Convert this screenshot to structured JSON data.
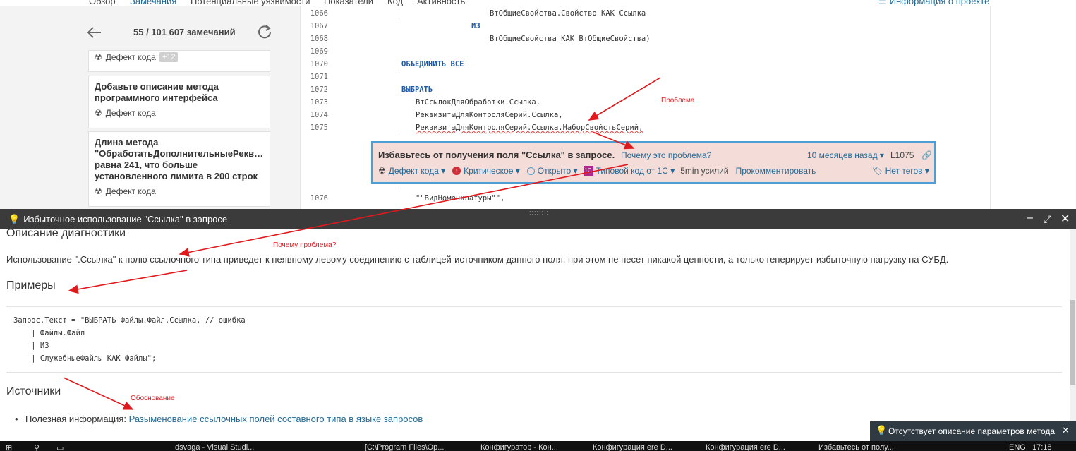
{
  "nav": {
    "tabs": [
      "Обзор",
      "Замечания",
      "Потенциальные уязвимости",
      "Показатели",
      "Код",
      "Активность"
    ],
    "project_info": "Информация о проекте"
  },
  "issues_list": {
    "counter": "55 / 101 607 замечаний",
    "cards": [
      {
        "title": "",
        "type": "Дефект кода",
        "badge": "+12"
      },
      {
        "title": "Добавьте описание метода программного интерфейса",
        "type": "Дефект кода"
      },
      {
        "title": "Длина метода \"ОбработатьДополнительныеРекв… равна 241, что больше установленного лимита в 200 строк",
        "type": "Дефект кода"
      }
    ]
  },
  "code": {
    "lines": [
      {
        "n": "1066",
        "text": "ВтОбщиеСвойства.Свойство КАК Ссылка"
      },
      {
        "n": "1067",
        "text": "ИЗ"
      },
      {
        "n": "1068",
        "text": "ВтОбщиеСвойства КАК ВтОбщиеСвойства)"
      },
      {
        "n": "1069",
        "text": ""
      },
      {
        "n": "1070",
        "text": "ОБЪЕДИНИТЬ ВСЕ"
      },
      {
        "n": "1071",
        "text": ""
      },
      {
        "n": "1072",
        "text": "ВЫБРАТЬ"
      },
      {
        "n": "1073",
        "text": "ВтСсылокДляОбработки.Ссылка,"
      },
      {
        "n": "1074",
        "text": "РеквизитыДляКонтроляСерий.Ссылка,"
      },
      {
        "n": "1075",
        "text": "РеквизитыДляКонтроляСерий.Ссылка.НаборСвойствСерий,"
      },
      {
        "n": "1076",
        "text": "\"\"ВидНоменклатуры\"\","
      }
    ]
  },
  "issue": {
    "message": "Избавьтесь от получения поля \"Ссылка\" в запросе.",
    "why": "Почему это проблема?",
    "age": "10 месяцев назад",
    "line": "L1075",
    "type": "Дефект кода",
    "severity": "Критическое",
    "status": "Открыто",
    "rule_tag": "Типовой код от 1С",
    "effort": "5min усилий",
    "comment": "Прокомментировать",
    "tags": "Нет тегов"
  },
  "panel": {
    "title": "Избыточное использование \"Ссылка\" в запросе",
    "h_description": "Описание диагностики",
    "description": "Использование \".Ссылка\" к полю ссылочного типа приведет к неявному левому соединению с таблицей-источником данного поля, при этом не несет никакой ценности, а только генерирует избыточную нагрузку на СУБД.",
    "h_examples": "Примеры",
    "example_code": "Запрос.Текст = \"ВЫБРАТЬ Файлы.Файл.Ссылка, // ошибка\n    | Файлы.Файл\n    | ИЗ\n    | СлужебныеФайлы КАК Файлы\";",
    "h_sources": "Источники",
    "source_prefix": "Полезная информация:",
    "source_link": "Разыменование ссылочных полей составного типа в языке запросов"
  },
  "annotations": {
    "problem": "Проблема",
    "why_problem": "Почему проблема?",
    "justification": "Обоснование"
  },
  "toast": {
    "text": "Отсутствует описание параметров метода"
  },
  "taskbar": {
    "items": [
      "dsvaga - Visual Studi...",
      "[C:\\Program Files\\Op...",
      "Конфигуратор - Кон...",
      "Конфигурация ere D...",
      "Конфигурация ere D...",
      "Избавьтесь от полу..."
    ],
    "lang": "ENG",
    "time": "17:18"
  },
  "colors": {
    "accent": "#4b9fd5",
    "link": "#236a97",
    "issue_bg": "#f4ddd9",
    "annotation": "#e0191d"
  }
}
